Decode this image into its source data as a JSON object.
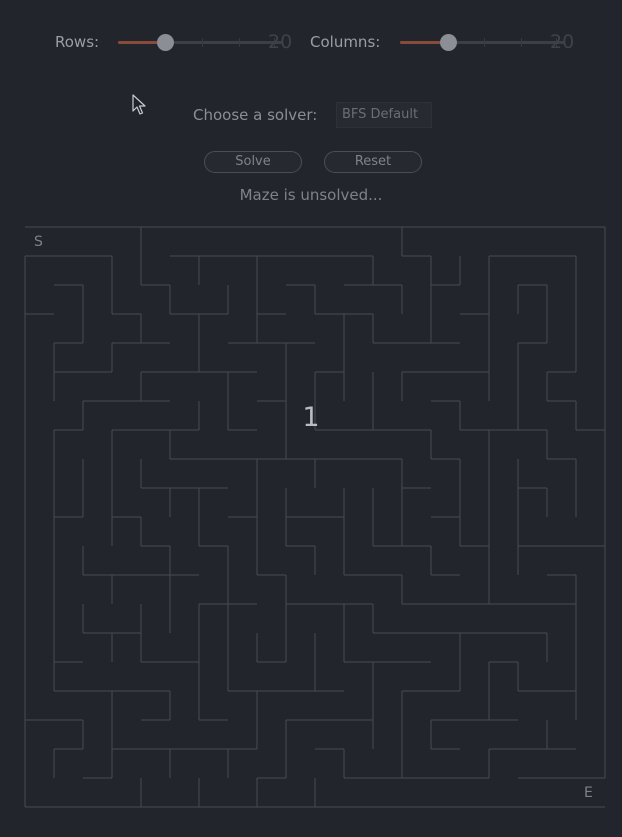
{
  "controls": {
    "rows": {
      "label": "Rows:",
      "value": "20",
      "fraction": 0.2
    },
    "columns": {
      "label": "Columns:",
      "value": "20",
      "fraction": 0.2
    }
  },
  "solver": {
    "label": "Choose a solver:",
    "selected": "BFS Default"
  },
  "buttons": {
    "solve": "Solve",
    "reset": "Reset"
  },
  "status_text": "Maze is unsolved...",
  "maze": {
    "rows": 20,
    "cols": 20,
    "start_label": "S",
    "end_label": "E",
    "center_label": "1",
    "wall_color": "#464a53"
  }
}
